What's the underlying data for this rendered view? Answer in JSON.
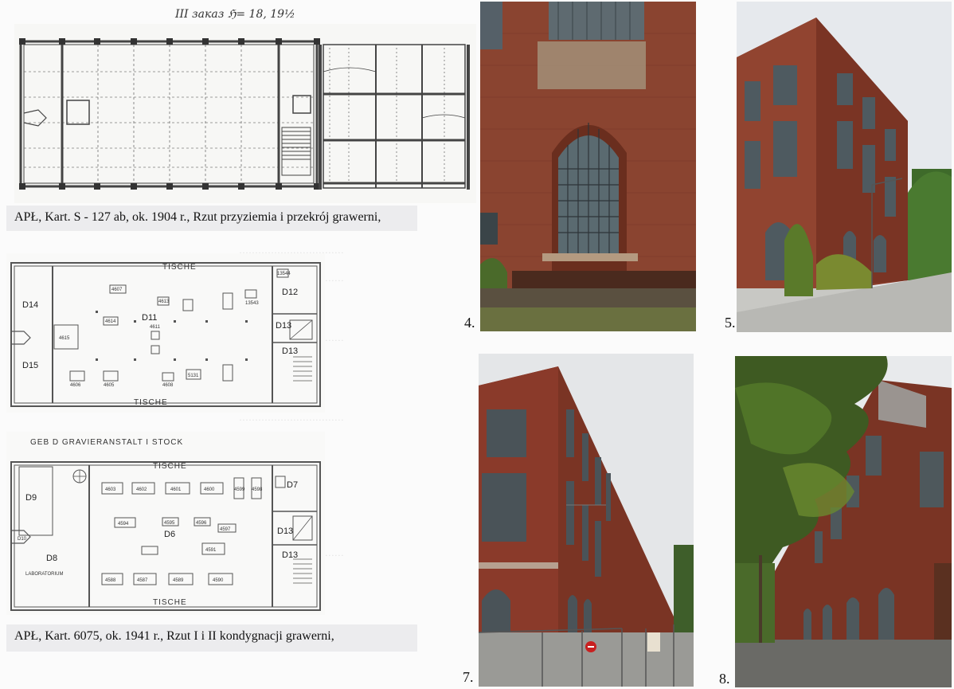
{
  "header_note": "III заказ ℌ= 18, 19½",
  "captions": {
    "top": "APŁ, Kart. S - 127 ab, ok. 1904 r., Rzut przyziemia i przekrój grawerni,",
    "bottom": "APŁ, Kart. 6075, ok. 1941 r., Rzut I i II kondygnacji grawerni,"
  },
  "plan2": {
    "label_top": "TISCHE",
    "label_bottom": "TISCHE",
    "rooms": [
      "D14",
      "D15",
      "D11",
      "D12",
      "D13",
      "D13"
    ],
    "items": [
      "4607",
      "4614",
      "4613",
      "4611",
      "4615",
      "4606",
      "4605",
      "4608",
      "5131",
      "13544",
      "13543"
    ]
  },
  "plan3": {
    "title": "GEB D   GRAVIERANSTALT   I STOCK",
    "label_top": "TISCHE",
    "label_bottom": "TISCHE",
    "rooms": [
      "D9",
      "D8",
      "D6",
      "D7",
      "D13",
      "D13",
      "D10"
    ],
    "laboratorium": "LABORATORIUM",
    "items": [
      "4603",
      "4602",
      "4601",
      "4600",
      "4599",
      "4598",
      "4594",
      "4595",
      "4596",
      "4597",
      "4591",
      "4588",
      "4587",
      "4589",
      "4590"
    ]
  },
  "photo_numbers": [
    "4.",
    "5.",
    "7.",
    "8."
  ],
  "colors": {
    "brick": "#8a3a2a",
    "sky": "#e8ebee",
    "caption_bg": "#ececee",
    "tree": "#4a6a2a"
  }
}
